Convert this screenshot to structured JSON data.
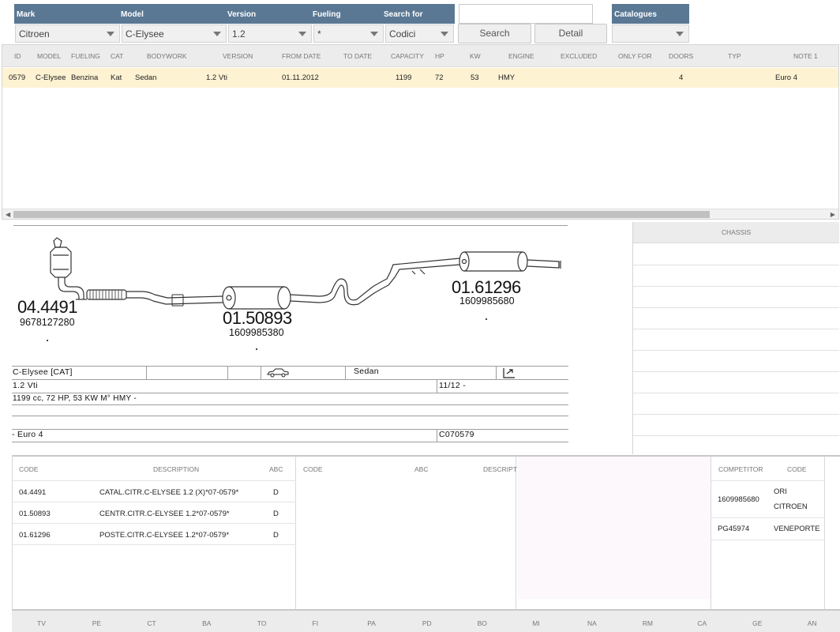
{
  "filters": {
    "mark": {
      "label": "Mark",
      "value": "Citroen"
    },
    "model": {
      "label": "Model",
      "value": "C-Elysee"
    },
    "version": {
      "label": "Version",
      "value": "1.2"
    },
    "fueling": {
      "label": "Fueling",
      "value": "*"
    },
    "search_for": {
      "label": "Search for",
      "value": "Codici"
    },
    "search_input": {
      "value": ""
    },
    "search_button": "Search",
    "detail_button": "Detail",
    "catalogues": {
      "label": "Catalogues",
      "value": ""
    }
  },
  "vehicle_grid": {
    "columns": [
      "ID",
      "MODEL",
      "FUELING",
      "CAT",
      "BODYWORK",
      "VERSION",
      "FROM DATE",
      "TO DATE",
      "CAPACITY",
      "HP",
      "KW",
      "ENGINE",
      "EXCLUDED",
      "ONLY FOR",
      "DOORS",
      "TYP",
      "NOTE 1"
    ],
    "row": {
      "id": "0579",
      "model": "C-Elysee",
      "fueling": "Benzina",
      "cat": "Kat",
      "bodywork": "Sedan",
      "version": "1.2 Vti",
      "from_date": "01.11.2012",
      "to_date": "",
      "capacity": "1199",
      "hp": "72",
      "kw": "53",
      "engine": "HMY",
      "excluded": "",
      "only_for": "",
      "doors": "4",
      "typ": "",
      "note1": "Euro 4"
    }
  },
  "drawing": {
    "parts": [
      {
        "code": "04.4491",
        "oe": "9678127280"
      },
      {
        "code": "01.50893",
        "oe": "1609985380"
      },
      {
        "code": "01.61296",
        "oe": "1609985680"
      }
    ],
    "legend": {
      "model_cat": "C-Elysee  [CAT]",
      "body": "Sedan",
      "version": "1.2 Vti",
      "date": "11/12 -",
      "engine_info": "1199 cc, 72 HP, 53 KW  M° HMY -",
      "norm": "- Euro 4",
      "code": "C070579"
    }
  },
  "chassis": {
    "header": "CHASSIS"
  },
  "parts_table": {
    "headers": {
      "code": "CODE",
      "description": "DESCRIPTION",
      "abc": "ABC"
    },
    "rows": [
      {
        "code": "04.4491",
        "description": "CATAL.CITR.C-ELYSEE 1.2 (X)*07-0579*",
        "abc": "D"
      },
      {
        "code": "01.50893",
        "description": "CENTR.CITR.C-ELYSEE 1.2*07-0579*",
        "abc": "D"
      },
      {
        "code": "01.61296",
        "description": "POSTE.CITR.C-ELYSEE 1.2*07-0579*",
        "abc": "D"
      }
    ]
  },
  "second_table": {
    "headers": {
      "code": "CODE",
      "abc": "ABC",
      "description": "DESCRIPT"
    }
  },
  "competitor_table": {
    "headers": {
      "competitor": "COMPETITOR",
      "code": "CODE"
    },
    "rows": [
      {
        "competitor": "1609985680",
        "code_line1": "ORI",
        "code_line2": "CITROEN"
      },
      {
        "competitor": "PG45974",
        "code_line1": "VENEPORTE",
        "code_line2": ""
      }
    ]
  },
  "languages": [
    "TV",
    "PE",
    "CT",
    "BA",
    "TO",
    "FI",
    "PA",
    "PD",
    "BO",
    "MI",
    "NA",
    "RM",
    "CA",
    "GE",
    "AN"
  ]
}
